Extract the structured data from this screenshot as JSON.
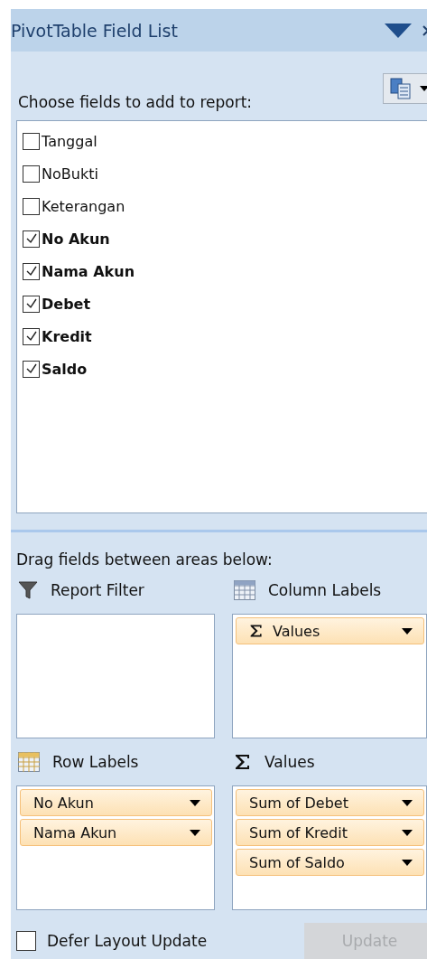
{
  "window": {
    "title": "PivotTable Field List"
  },
  "fields_section": {
    "label": "Choose fields to add to report:"
  },
  "fields": [
    {
      "label": "Tanggal",
      "checked": false
    },
    {
      "label": "NoBukti",
      "checked": false
    },
    {
      "label": "Keterangan",
      "checked": false
    },
    {
      "label": "No Akun",
      "checked": true
    },
    {
      "label": "Nama Akun",
      "checked": true
    },
    {
      "label": "Debet",
      "checked": true
    },
    {
      "label": "Kredit",
      "checked": true
    },
    {
      "label": "Saldo",
      "checked": true
    }
  ],
  "areas_section": {
    "label": "Drag fields between areas below:"
  },
  "areas": [
    {
      "kind": "filter",
      "title": "Report Filter"
    },
    {
      "kind": "columns",
      "title": "Column Labels",
      "items": [
        {
          "label": "Values",
          "kind": "sigma"
        }
      ]
    },
    {
      "kind": "rows",
      "title": "Row Labels",
      "items": [
        {
          "label": "No Akun",
          "kind": "field"
        },
        {
          "label": "Nama Akun",
          "kind": "field"
        }
      ]
    },
    {
      "kind": "values",
      "title": "Values",
      "items": [
        {
          "label": "Sum of Debet",
          "kind": "field"
        },
        {
          "label": "Sum of Kredit",
          "kind": "field"
        },
        {
          "label": "Sum of Saldo",
          "kind": "field"
        }
      ]
    }
  ],
  "defer_update": {
    "label": "Defer Layout Update",
    "checked": false
  },
  "update_button": {
    "label": "Update",
    "disabled": true
  }
}
